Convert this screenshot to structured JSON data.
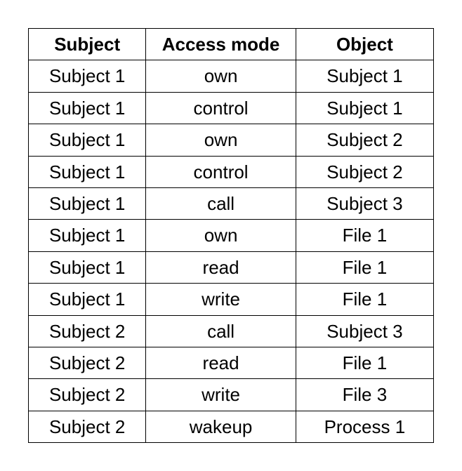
{
  "chart_data": {
    "type": "table",
    "headers": {
      "subject": "Subject",
      "access_mode": "Access mode",
      "object": "Object"
    },
    "rows": [
      {
        "subject": "Subject 1",
        "access_mode": "own",
        "object": "Subject 1"
      },
      {
        "subject": "Subject 1",
        "access_mode": "control",
        "object": "Subject 1"
      },
      {
        "subject": "Subject 1",
        "access_mode": "own",
        "object": "Subject 2"
      },
      {
        "subject": "Subject 1",
        "access_mode": "control",
        "object": "Subject 2"
      },
      {
        "subject": "Subject 1",
        "access_mode": "call",
        "object": "Subject 3"
      },
      {
        "subject": "Subject 1",
        "access_mode": "own",
        "object": "File 1"
      },
      {
        "subject": "Subject 1",
        "access_mode": "read",
        "object": "File 1"
      },
      {
        "subject": "Subject 1",
        "access_mode": "write",
        "object": "File 1"
      },
      {
        "subject": "Subject 2",
        "access_mode": "call",
        "object": "Subject 3"
      },
      {
        "subject": "Subject 2",
        "access_mode": "read",
        "object": "File 1"
      },
      {
        "subject": "Subject 2",
        "access_mode": "write",
        "object": "File 3"
      },
      {
        "subject": "Subject 2",
        "access_mode": "wakeup",
        "object": "Process 1"
      }
    ]
  }
}
